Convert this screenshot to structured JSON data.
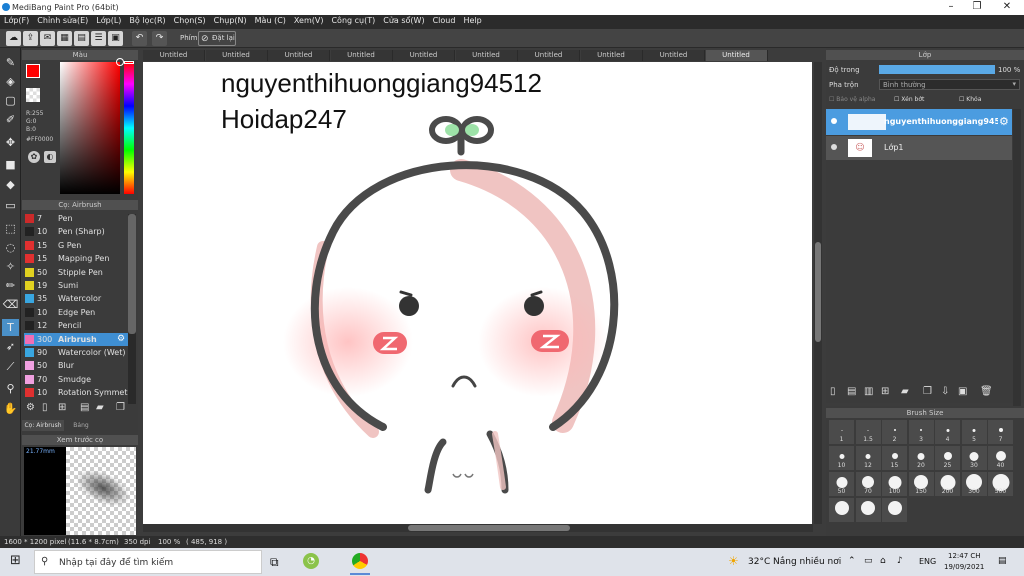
{
  "window": {
    "title": "MediBang Paint Pro (64bit)",
    "min": "–",
    "max": "❐",
    "close": "✕"
  },
  "menu": [
    "Lớp(F)",
    "Chỉnh sửa(E)",
    "Lớp(L)",
    "Bộ lọc(R)",
    "Chọn(S)",
    "Chụp(N)",
    "Màu (C)",
    "Xem(V)",
    "Công cụ(T)",
    "Cửa sổ(W)",
    "Cloud",
    "Help"
  ],
  "toolbar": {
    "key_label": "Phím",
    "reset_label": "Đặt lại"
  },
  "color_panel": {
    "title": "Màu",
    "r": "R:255",
    "g": "G:0",
    "b": "B:0",
    "hex": "#FF0000",
    "primary": "#ff0000",
    "secondary": "#000000"
  },
  "brush_panel": {
    "title": "Cọ: Airbrush",
    "items": [
      {
        "color": "#cc2a2a",
        "size": "7",
        "name": "Pen"
      },
      {
        "color": "#222222",
        "size": "10",
        "name": "Pen (Sharp)"
      },
      {
        "color": "#e03030",
        "size": "15",
        "name": "G Pen"
      },
      {
        "color": "#e03030",
        "size": "15",
        "name": "Mapping Pen"
      },
      {
        "color": "#e0d020",
        "size": "50",
        "name": "Stipple Pen"
      },
      {
        "color": "#e0d020",
        "size": "19",
        "name": "Sumi"
      },
      {
        "color": "#39a6e0",
        "size": "35",
        "name": "Watercolor"
      },
      {
        "color": "#222222",
        "size": "10",
        "name": "Edge Pen"
      },
      {
        "color": "#222222",
        "size": "12",
        "name": "Pencil"
      },
      {
        "color": "#f06eb4",
        "size": "300",
        "name": "Airbrush"
      },
      {
        "color": "#39a6e0",
        "size": "90",
        "name": "Watercolor (Wet)"
      },
      {
        "color": "#f0a0e0",
        "size": "50",
        "name": "Blur"
      },
      {
        "color": "#f0a0e0",
        "size": "70",
        "name": "Smudge"
      },
      {
        "color": "#e03030",
        "size": "10",
        "name": "Rotation Symmetry"
      }
    ],
    "selected_index": 9,
    "tab1": "Cọ: Airbrush",
    "tab2": "Bảng màu"
  },
  "preview": {
    "title": "Xem trước cọ",
    "size": "21.77mm"
  },
  "tabs": [
    "Untitled",
    "Untitled",
    "Untitled",
    "Untitled",
    "Untitled",
    "Untitled",
    "Untitled",
    "Untitled",
    "Untitled",
    "Untitled"
  ],
  "canvas_text": {
    "line1": "nguyenthihuonggiang94512",
    "line2": "Hoidap247"
  },
  "layers": {
    "title": "Lớp",
    "opacity_label": "Độ trong",
    "opacity_value": "100 %",
    "opacity_fraction": 1.0,
    "blend_label": "Pha trộn",
    "blend_value": "Bình thường",
    "protect_alpha": "Bảo vệ alpha",
    "clip": "Xén bớt",
    "lock": "Khóa",
    "items": [
      {
        "name": "nguyenthihuonggiang94512"
      },
      {
        "name": "Lớp1"
      }
    ]
  },
  "brush_size": {
    "title": "Brush Size",
    "labels": [
      "1",
      "1.5",
      "2",
      "3",
      "4",
      "5",
      "7",
      "10",
      "12",
      "15",
      "20",
      "25",
      "30",
      "40",
      "50",
      "70",
      "100",
      "150",
      "200",
      "300",
      "500",
      "",
      "",
      ""
    ]
  },
  "status": {
    "dimensions": "1600 * 1200 pixel",
    "size_cm": "(11.6 * 8.7cm)",
    "dpi": "350 dpi",
    "zoom": "100 %",
    "coords": "( 485, 918 )"
  },
  "taskbar": {
    "search": "Nhập tại đây để tìm kiếm",
    "weather_temp": "32°C",
    "weather_text": "Nắng nhiều nơi",
    "lang": "ENG",
    "time": "12:47 CH",
    "date": "19/09/2021"
  }
}
